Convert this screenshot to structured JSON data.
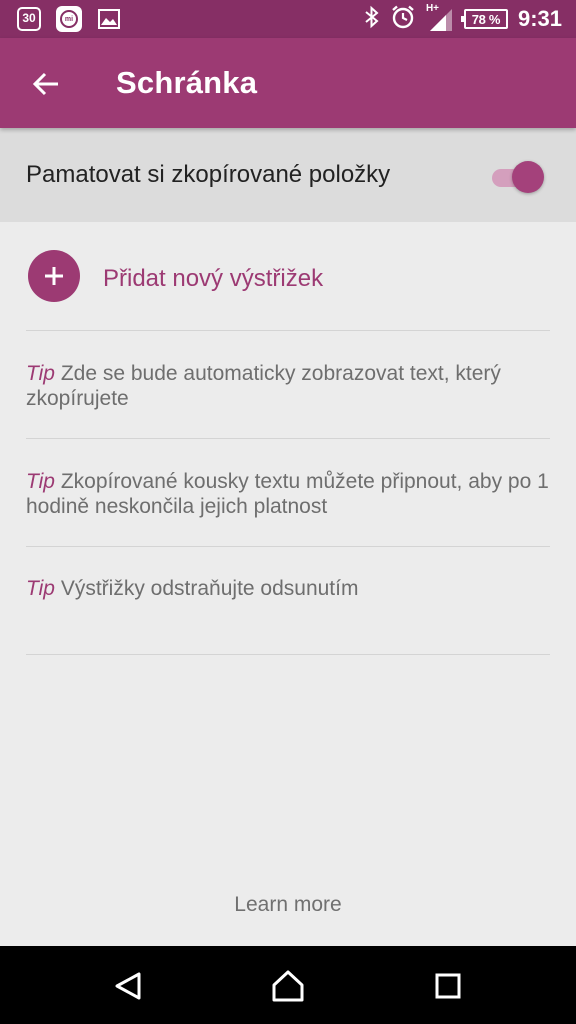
{
  "status_bar": {
    "calendar_day": "30",
    "mi_badge": "mi",
    "network_type": "H+",
    "battery": "78 %",
    "time": "9:31",
    "icons": [
      "calendar-icon",
      "mi-fit-icon",
      "gallery-icon",
      "bluetooth-icon",
      "alarm-icon",
      "signal-icon",
      "battery-icon"
    ]
  },
  "app_bar": {
    "title": "Schránka",
    "back_icon": "arrow-back-icon",
    "background": "#9c3a73"
  },
  "settings": {
    "remember_label": "Pamatovat si zkopírované položky",
    "remember_enabled": true
  },
  "add_clip": {
    "label": "Přidat nový výstřižek",
    "icon": "plus-icon"
  },
  "tips": [
    {
      "prefix": "Tip",
      "text": "Zde se bude automaticky zobrazovat text, který zkopírujete"
    },
    {
      "prefix": "Tip",
      "text": "Zkopírované kousky textu můžete připnout, aby po 1 hodině neskončila jejich platnost"
    },
    {
      "prefix": "Tip",
      "text": "Výstřižky odstraňujte odsunutím"
    }
  ],
  "footer": {
    "learn_more": "Learn more"
  },
  "nav_bar": {
    "icons": [
      "back-triangle-icon",
      "home-icon",
      "recents-icon"
    ]
  },
  "colors": {
    "accent": "#9c3a73",
    "status_bar": "#862f65",
    "background": "#ececec"
  }
}
